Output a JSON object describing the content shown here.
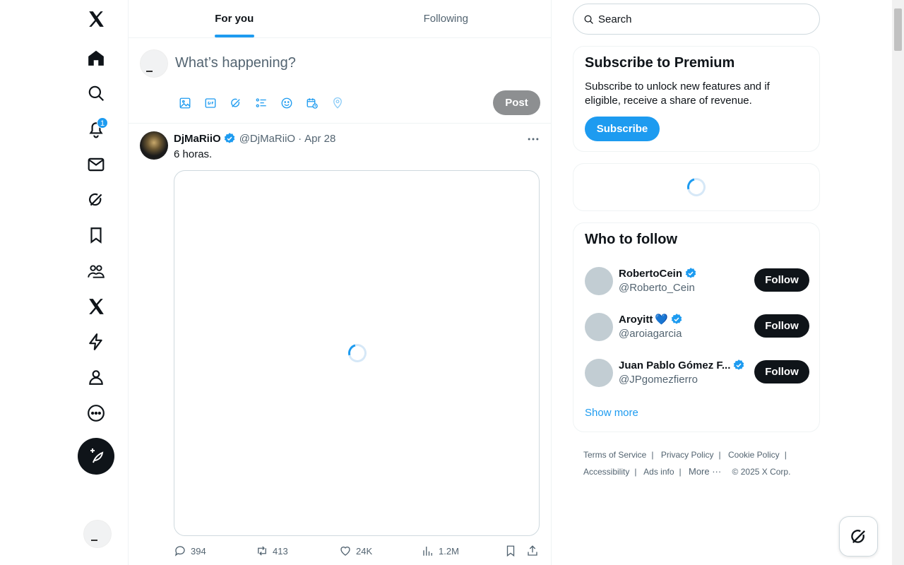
{
  "nav": {
    "items": [
      "x-logo-icon",
      "home-icon",
      "explore-icon",
      "notifications-icon",
      "messages-icon",
      "grok-icon",
      "bookmarks-icon",
      "communities-icon",
      "premium-icon",
      "verified-orgs-icon",
      "profile-icon",
      "more-icon"
    ],
    "notification_count": "1"
  },
  "tabs": [
    {
      "label": "For you",
      "active": true
    },
    {
      "label": "Following",
      "active": false
    }
  ],
  "composer": {
    "placeholder": "What’s happening?",
    "post_label": "Post"
  },
  "tweet": {
    "name": "DjMaRiiO",
    "handle": "@DjMaRiiO",
    "separator": "·",
    "date": "Apr 28",
    "text": "6 horas.",
    "replies": "394",
    "reposts": "413",
    "likes": "24K",
    "views": "1.2M"
  },
  "search": {
    "placeholder": "Search"
  },
  "premium": {
    "title": "Subscribe to Premium",
    "body": "Subscribe to unlock new features and if eligible, receive a share of revenue.",
    "button": "Subscribe"
  },
  "who_to_follow": {
    "title": "Who to follow",
    "users": [
      {
        "name": "RobertoCein",
        "emoji": "",
        "handle": "@Roberto_Cein",
        "button": "Follow"
      },
      {
        "name": "Aroyitt",
        "emoji": "💙",
        "handle": "@aroiagarcia",
        "button": "Follow"
      },
      {
        "name": "Juan Pablo Gómez F...",
        "emoji": "",
        "handle": "@JPgomezfierro",
        "button": "Follow"
      }
    ],
    "show_more": "Show more"
  },
  "footer": {
    "terms": "Terms of Service",
    "privacy": "Privacy Policy",
    "cookie": "Cookie Policy",
    "accessibility": "Accessibility",
    "ads": "Ads info",
    "more": "More ···",
    "copyright": "© 2025 X Corp."
  },
  "colors": {
    "accent": "#1d9bf0",
    "text": "#0f1419",
    "secondary": "#536471"
  }
}
